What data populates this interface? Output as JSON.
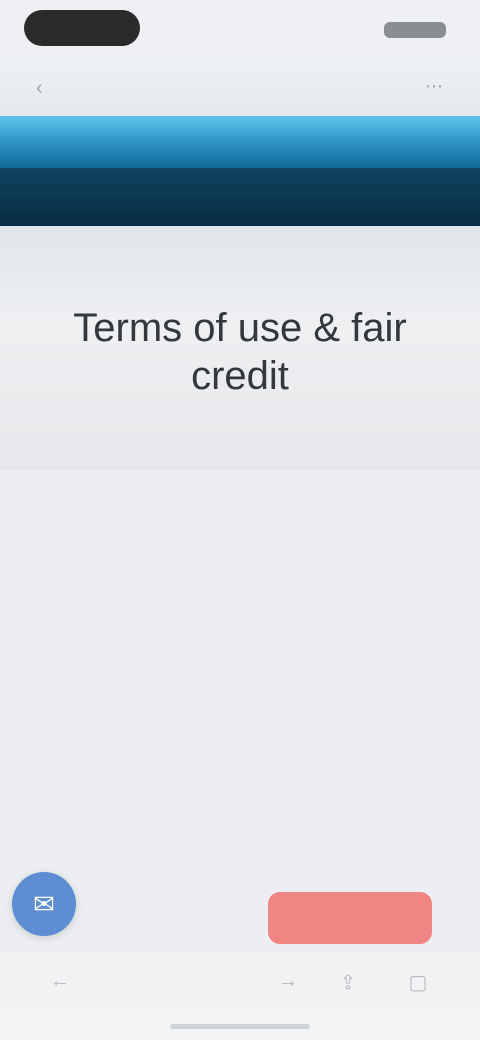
{
  "browser": {
    "title": "",
    "back_icon": "chevron-left-icon",
    "menu_icon": "menu-icon"
  },
  "nav": {
    "label": "",
    "right_label": ""
  },
  "hero": {
    "title": "Terms of use & fair credit"
  },
  "content": {
    "meta": "",
    "body": ""
  },
  "actions": {
    "fab_icon": "chat-icon",
    "cta_label": ""
  },
  "colors": {
    "header_accent": "#2a8fc0",
    "nav_dark": "#0a2d43",
    "fab": "#5d8ed2",
    "cta": "#ef8683"
  }
}
